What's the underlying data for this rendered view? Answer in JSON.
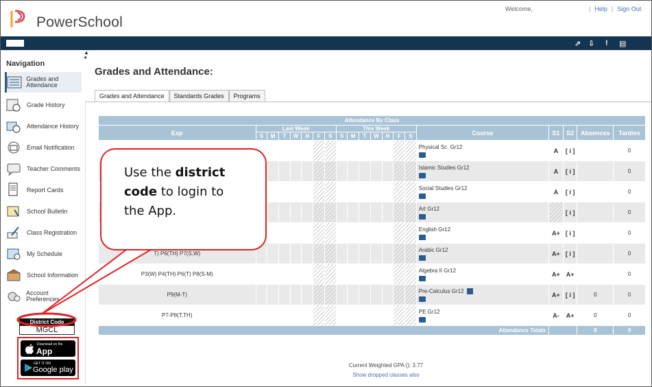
{
  "header": {
    "app_name": "PowerSchool",
    "welcome": "Welcome,",
    "help": "Help",
    "sign_out": "Sign Out"
  },
  "sidebar": {
    "title": "Navigation",
    "items": [
      {
        "label": "Grades and Attendance",
        "icon": "grades-icon",
        "selected": true
      },
      {
        "label": "Grade History",
        "icon": "grade-history-icon"
      },
      {
        "label": "Attendance History",
        "icon": "attendance-icon"
      },
      {
        "label": "Email Notification",
        "icon": "email-icon"
      },
      {
        "label": "Teacher Comments",
        "icon": "comment-icon"
      },
      {
        "label": "Report Cards",
        "icon": "report-card-icon"
      },
      {
        "label": "School Bulletin",
        "icon": "bulletin-icon"
      },
      {
        "label": "Class Registration",
        "icon": "registration-icon"
      },
      {
        "label": "My Schedule",
        "icon": "schedule-icon"
      },
      {
        "label": "School Information",
        "icon": "school-icon"
      },
      {
        "label": "Account Preferences",
        "icon": "preferences-icon"
      }
    ],
    "district_code_label": "District Code",
    "district_code_value": "MGCL",
    "app_store_top": "Download on the",
    "app_store_name": "App Store",
    "google_play_top": "GET IT ON",
    "google_play_name": "Google play"
  },
  "main": {
    "title": "Grades and Attendance:",
    "tabs": [
      "Grades and Attendance",
      "Standards Grades",
      "Programs"
    ],
    "table": {
      "caption": "Attendance By Class",
      "col_exp": "Exp",
      "col_last_week": "Last Week",
      "col_this_week": "This Week",
      "days": [
        "S",
        "M",
        "T",
        "W",
        "H",
        "F",
        "S",
        "S",
        "M",
        "T",
        "W",
        "H",
        "F",
        "S"
      ],
      "col_course": "Course",
      "col_s1": "S1",
      "col_s2": "S2",
      "col_absences": "Absences",
      "col_tardies": "Tardies",
      "rows": [
        {
          "exp": "",
          "course": "Physical Sc. Gr12",
          "s1": "A",
          "s2": "[ i ]",
          "absences": "",
          "tardies": "0"
        },
        {
          "exp": "",
          "course": "Islamic Studies Gr12",
          "s1": "A",
          "s2": "[ i ]",
          "absences": "",
          "tardies": "0"
        },
        {
          "exp": "",
          "course": "Social Studies Gr12",
          "s1": "A",
          "s2": "[ i ]",
          "absences": "",
          "tardies": "0"
        },
        {
          "exp": "",
          "course": "Art Gr12",
          "s1": "",
          "s2": "[ i ]",
          "absences": "",
          "tardies": "0"
        },
        {
          "exp": "",
          "course": "English Gr12",
          "s1": "A+",
          "s2": "[ i ]",
          "absences": "",
          "tardies": "0"
        },
        {
          "exp": "T) P6(TH) P7(S,W)",
          "course": "Arabic Gr12",
          "s1": "A+",
          "s2": "[ i ]",
          "absences": "",
          "tardies": "0"
        },
        {
          "exp": "P3(W) P4(TH) P6(T) P8(S-M)",
          "course": "Algebra II Gr12",
          "s1": "A+",
          "s2": "A+",
          "absences": "",
          "tardies": "0"
        },
        {
          "exp": "P9(M-T)",
          "course": "Pre-Calculus Gr12",
          "s1": "A+",
          "s2": "[ i ]",
          "absences": "0",
          "tardies": "0"
        },
        {
          "exp": "P7-P8(T,TH)",
          "course": "PE Gr12",
          "s1": "A-",
          "s2": "A+",
          "absences": "0",
          "tardies": "0"
        }
      ],
      "totals_label": "Attendance Totals",
      "totals_absences": "8",
      "totals_tardies": "0"
    },
    "gpa": "Current Weighted GPA (): 3.77",
    "dropped_link": "Show dropped classes also"
  },
  "callout": {
    "part1": "Use the ",
    "bold1": "district",
    "bold2": "code",
    "part2": " to login to",
    "part3": "the App."
  },
  "colors": {
    "navbar": "#15344f",
    "table_header": "#a9c3d6",
    "callout_border": "#e02020",
    "grade": "#1a4f8a"
  }
}
